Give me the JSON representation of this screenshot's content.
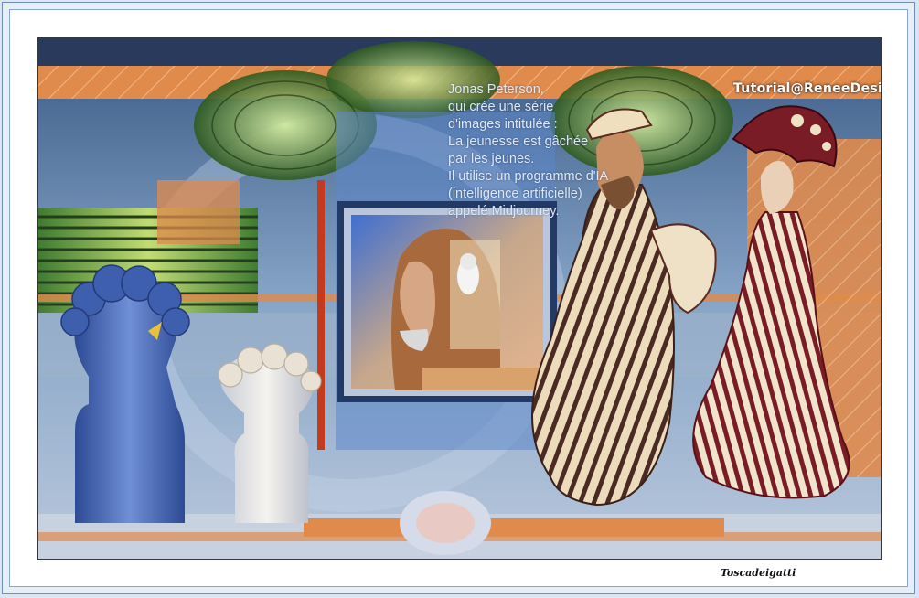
{
  "artwork": {
    "caption": "Jonas Peterson,\nqui crée une série\nd'images intitulée :\nLa jeunesse est gâchée\npar les jeunes.\nIl utilise un programme d'IA\n(intelligence artificielle)\nappelé Midjourney.",
    "credit": "Tutorial@ReneeDesigns",
    "colors": {
      "orange": "#e08a4c",
      "navy": "#2a3a5c",
      "green": "#7fb03a",
      "cream": "#e9d9b8",
      "maroon": "#7a1c26",
      "blue_bust": "#4e6eb8"
    }
  },
  "signature": "Toscadeigatti"
}
